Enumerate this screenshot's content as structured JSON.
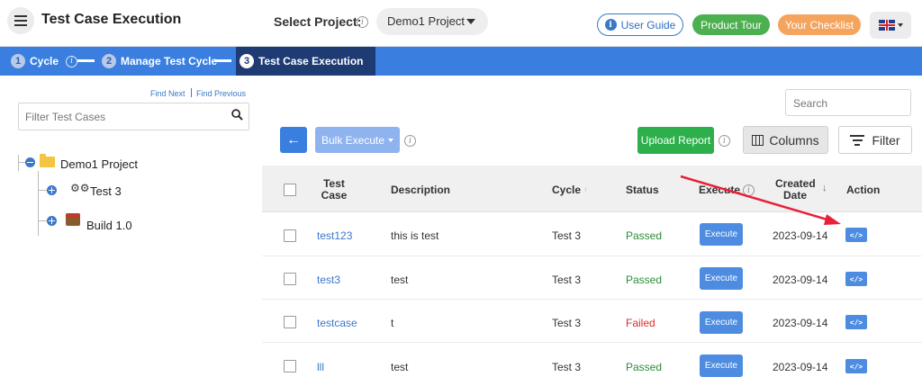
{
  "header": {
    "title": "Test Case Execution",
    "project_label": "Select Project:",
    "project_value": "Demo1 Project",
    "user_guide": "User Guide",
    "product_tour": "Product Tour",
    "your_checklist": "Your Checklist",
    "language_flag": "uk-flag-icon"
  },
  "steps": [
    {
      "num": "1",
      "label": "Cycle"
    },
    {
      "num": "2",
      "label": "Manage Test Cycle"
    },
    {
      "num": "3",
      "label": "Test Case Execution",
      "active": true
    }
  ],
  "sidebar": {
    "find_next": "Find Next",
    "find_previous": "Find Previous",
    "filter_placeholder": "Filter Test Cases",
    "tree": {
      "root": "Demo1 Project",
      "children": [
        "Test 3",
        "Build 1.0"
      ]
    }
  },
  "toolbar": {
    "search_placeholder": "Search",
    "bulk_execute": "Bulk Execute",
    "upload_report": "Upload Report",
    "columns": "Columns",
    "filter": "Filter"
  },
  "table": {
    "headers": {
      "test_case_1": "Test",
      "test_case_2": "Case",
      "description": "Description",
      "cycle": "Cycle",
      "status": "Status",
      "execute": "Execute",
      "created_1": "Created",
      "created_2": "Date",
      "action": "Action"
    },
    "rows": [
      {
        "test_case": "test123",
        "description": "this is test",
        "cycle": "Test 3",
        "status": "Passed",
        "execute": "Execute",
        "created": "2023-09-14",
        "action": "</>"
      },
      {
        "test_case": "test3",
        "description": "test",
        "cycle": "Test 3",
        "status": "Passed",
        "execute": "Execute",
        "created": "2023-09-14",
        "action": "</>"
      },
      {
        "test_case": "testcase",
        "description": "t",
        "cycle": "Test 3",
        "status": "Failed",
        "execute": "Execute",
        "created": "2023-09-14",
        "action": "</>"
      },
      {
        "test_case": "lll",
        "description": "test",
        "cycle": "Test 3",
        "status": "Passed",
        "execute": "Execute",
        "created": "2023-09-14",
        "action": "</>"
      }
    ]
  },
  "colors": {
    "accent": "#3a7fe0",
    "passed": "#2e8b3a",
    "failed": "#e02a2a",
    "annotation_arrow": "#e8203a"
  }
}
